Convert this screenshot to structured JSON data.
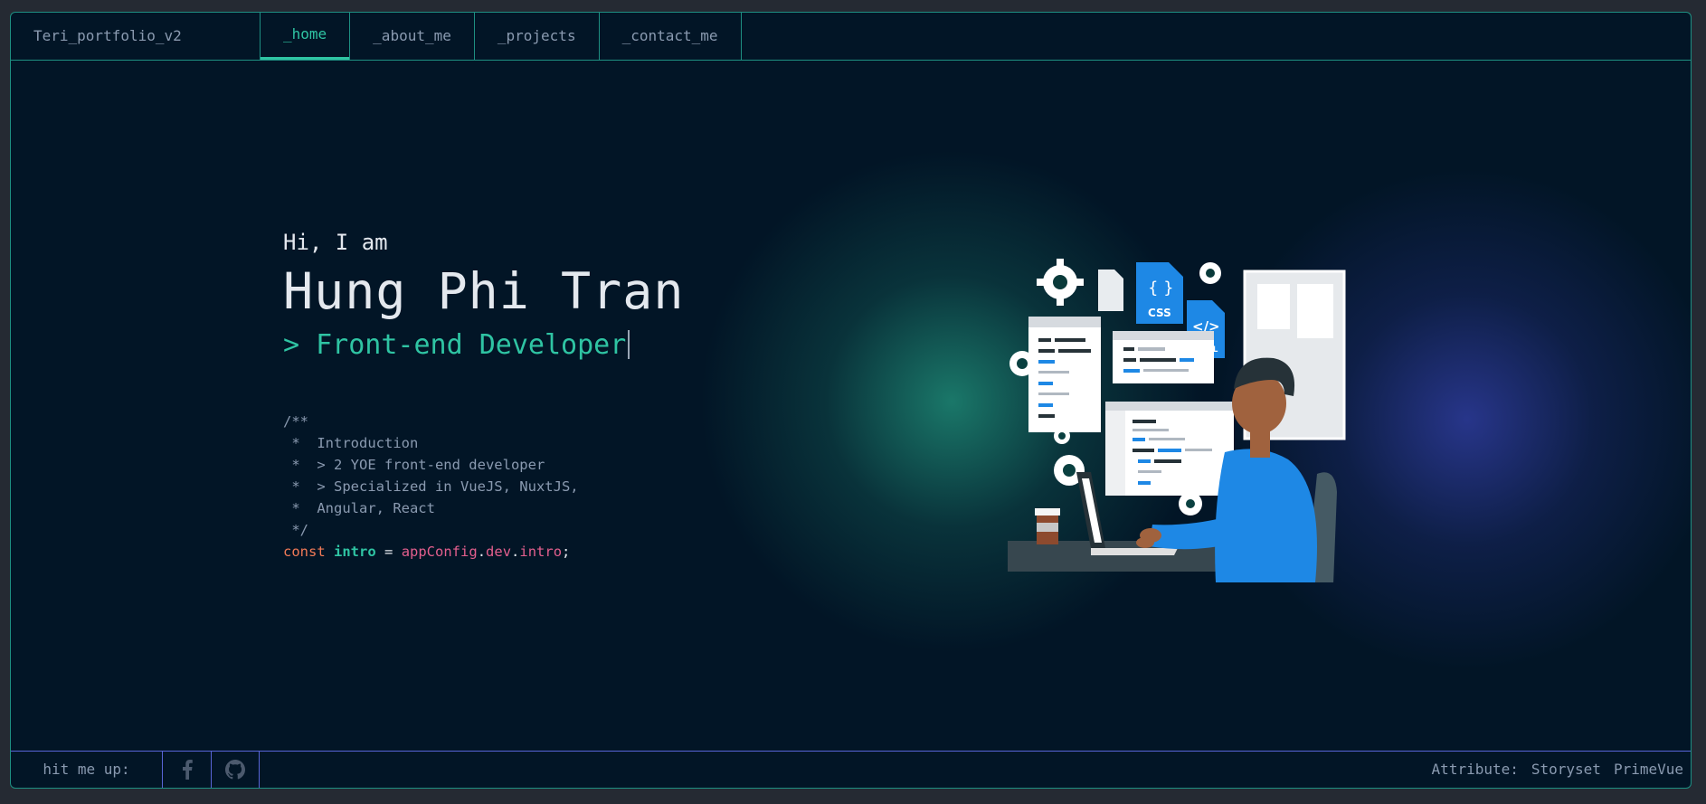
{
  "header": {
    "brand": "Teri_portfolio_v2",
    "tabs": [
      {
        "label": "_home",
        "active": true
      },
      {
        "label": "_about_me",
        "active": false
      },
      {
        "label": "_projects",
        "active": false
      },
      {
        "label": "_contact_me",
        "active": false
      }
    ]
  },
  "hero": {
    "greeting": "Hi, I am",
    "name": "Hung Phi Tran",
    "role": "> Front-end Developer",
    "comment_lines": [
      "/**",
      " *  Introduction",
      " *  > 2 YOE front-end developer",
      " *  > Specialized in VueJS, NuxtJS,",
      " *  Angular, React",
      " */"
    ],
    "code": {
      "keyword": "const",
      "variable": "intro",
      "operator": " = ",
      "obj1": "appConfig",
      "dot1": ".",
      "obj2": "dev",
      "dot2": ".",
      "obj3": "intro",
      "end": ";"
    }
  },
  "illustration": {
    "file_labels": [
      "CSS",
      "HTML"
    ],
    "icons": [
      "css-file-icon",
      "html-file-icon",
      "gear-icon",
      "coffee-cup-icon",
      "laptop-icon"
    ]
  },
  "footer": {
    "hit_label": "hit me up:",
    "socials": [
      {
        "name": "facebook-icon"
      },
      {
        "name": "github-icon"
      }
    ],
    "attribute_label": "Attribute:",
    "links": [
      "Storyset",
      "PrimeVue"
    ]
  },
  "colors": {
    "background": "#021526",
    "accent_green": "#2fc4a3",
    "accent_blue": "#5865d8",
    "keyword": "#f27a57",
    "object": "#e45f8e",
    "text_muted": "#8a9ab0"
  }
}
